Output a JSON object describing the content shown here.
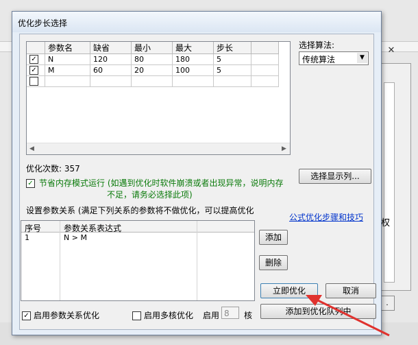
{
  "window": {
    "title": "优化步长选择"
  },
  "grid": {
    "columns": [
      "",
      "参数名",
      "缺省",
      "最小",
      "最大",
      "步长",
      ""
    ],
    "rows": [
      {
        "checked": true,
        "name": "N",
        "default": "120",
        "min": "80",
        "max": "180",
        "step": "5"
      },
      {
        "checked": true,
        "name": "M",
        "default": "60",
        "min": "20",
        "max": "100",
        "step": "5"
      },
      {
        "checked": false,
        "name": "",
        "default": "",
        "min": "",
        "max": "",
        "step": ""
      }
    ]
  },
  "algorithm": {
    "label": "选择算法:",
    "value": "传统算法"
  },
  "opt_count": "优化次数: 357",
  "save_memory": {
    "checked": true,
    "text_line1": "节省内存模式运行 (如遇到优化时软件崩溃或者出现异常，说明内存",
    "text_line2": "不足，请务必选择此项)"
  },
  "select_columns_button": "选择显示列...",
  "relation": {
    "header": "设置参数关系 (满足下列关系的参数将不做优化，可以提高优化",
    "columns": [
      "序号",
      "参数关系表达式"
    ],
    "rows": [
      {
        "index": "1",
        "expr": "N > M"
      }
    ],
    "add_button": "添加",
    "delete_button": "删除"
  },
  "tips_link": "公式优化步骤和技巧",
  "optimize_button": "立即优化",
  "cancel_button": "取消",
  "add_queue_button": "添加到优化队列中",
  "enable_relation": {
    "checked": true,
    "label": "启用参数关系优化"
  },
  "multicore": {
    "checked": false,
    "label": "启用多核优化",
    "enable_label": "启用",
    "cores": "8",
    "cores_unit": "核"
  },
  "background": {
    "side_char": "权",
    "btn_char": "."
  },
  "colors": {
    "dialog_bg": "#f0f0f0",
    "titlebar": "#dbe6f3",
    "link": "#0033cc",
    "green_text": "#0a7a0a",
    "arrow": "#e0322e"
  }
}
